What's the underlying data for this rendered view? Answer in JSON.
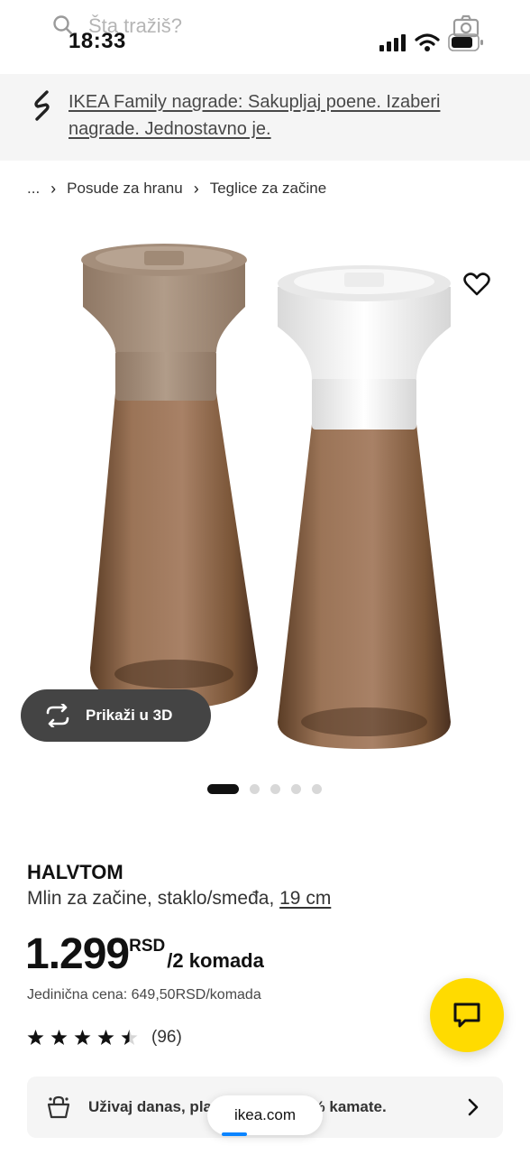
{
  "status_bar": {
    "time": "18:33"
  },
  "search": {
    "placeholder": "Šta tražiš?"
  },
  "banner": {
    "text": "IKEA Family nagrade: Sakupljaj poene. Izaberi nagrade. Jednostavno je."
  },
  "breadcrumb": {
    "ellipsis": "...",
    "items": [
      "Posude za hranu",
      "Teglice za začine"
    ]
  },
  "media": {
    "view_3d_label": "Prikaži u 3D",
    "dots_count": 5,
    "active_dot": 0
  },
  "product": {
    "name": "HALVTOM",
    "description": "Mlin za začine, staklo/smeđa, ",
    "size_link": "19 cm",
    "price_main": "1.299",
    "price_currency": "RSD",
    "price_unit": "/2 komada",
    "unit_price": "Jedinična cena: 649,50RSD/komada",
    "rating_value": 4.5,
    "review_count": "(96)"
  },
  "finance": {
    "text": "Uživaj danas, plati kasnije uz 0% kamate."
  },
  "browser": {
    "url": "ikea.com"
  },
  "colors": {
    "accent_yellow": "#ffdb00",
    "dark_button": "#444444",
    "banner_bg": "#f5f5f5"
  }
}
